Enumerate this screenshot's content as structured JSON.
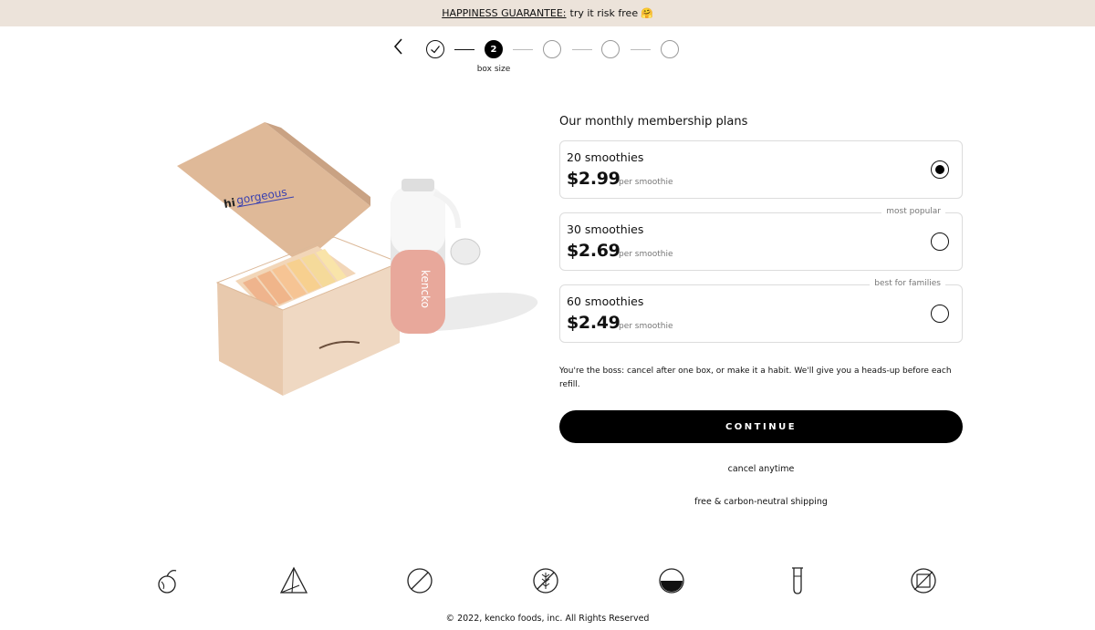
{
  "banner": {
    "guarantee": "HAPPINESS GUARANTEE:",
    "text": "try it risk free",
    "emoji": "🤗"
  },
  "stepper": {
    "active_number": "2",
    "active_label": "box size",
    "steps_total": 5
  },
  "hero": {
    "box_text_hi": "hi",
    "box_text_gorgeous": "gorgeous",
    "bottle_text": "kencko"
  },
  "plans": {
    "title": "Our monthly membership plans",
    "items": [
      {
        "count": "20 smoothies",
        "price": "$2.99",
        "unit": "per smoothie",
        "tag": "",
        "selected": true
      },
      {
        "count": "30 smoothies",
        "price": "$2.69",
        "unit": "per smoothie",
        "tag": "most popular",
        "selected": false
      },
      {
        "count": "60 smoothies",
        "price": "$2.49",
        "unit": "per smoothie",
        "tag": "best for families",
        "selected": false
      }
    ]
  },
  "note": "You're the boss: cancel after one box, or make it a habit. We'll give you a heads-up before each refill.",
  "cta": {
    "label": "CONTINUE"
  },
  "perks": {
    "cancel": "cancel anytime",
    "shipping": "free & carbon-neutral shipping"
  },
  "icons": [
    "fruit-icon",
    "pyramid-icon",
    "no-sugar-icon",
    "no-gluten-icon",
    "half-bowl-icon",
    "test-tube-icon",
    "crossed-box-icon"
  ],
  "footer": "© 2022, kencko foods, inc. All Rights Reserved"
}
